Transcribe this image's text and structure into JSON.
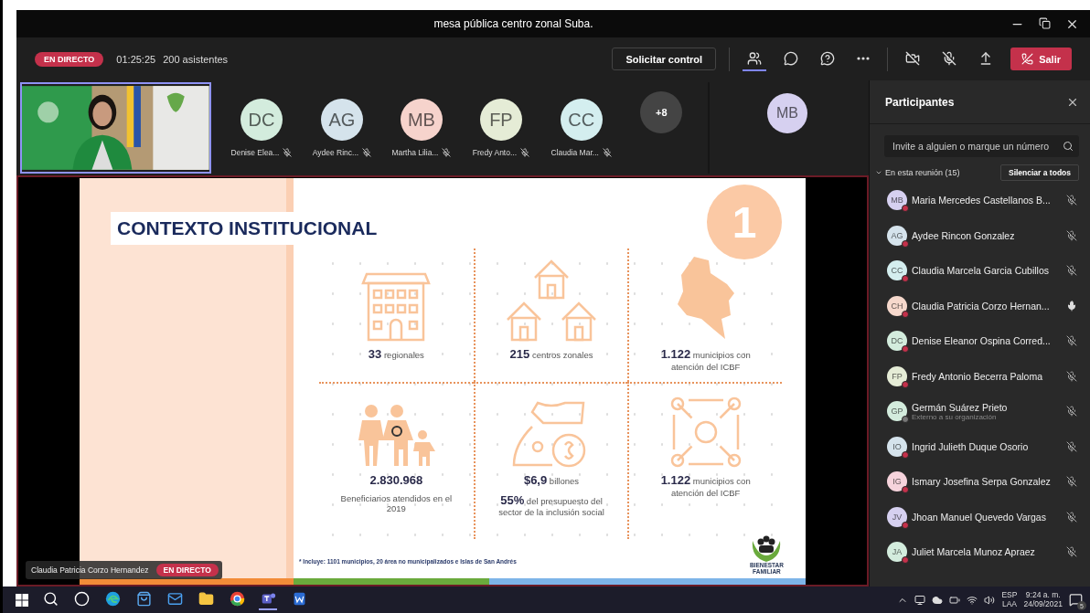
{
  "window": {
    "title": "mesa pública centro zonal Suba."
  },
  "toolbar": {
    "live_badge": "EN DIRECTO",
    "elapsed": "01:25:25",
    "attendees": "200 asistentes",
    "request_control": "Solicitar control",
    "actions": [
      {
        "kind": "people",
        "selected": true
      },
      {
        "kind": "chat",
        "selected": false
      },
      {
        "kind": "qa",
        "selected": false
      },
      {
        "kind": "more",
        "selected": false
      }
    ],
    "devices": [
      {
        "kind": "camera-off"
      },
      {
        "kind": "mic-off"
      },
      {
        "kind": "share"
      }
    ],
    "leave": "Salir"
  },
  "gallery": {
    "tiles": [
      {
        "initials": "DC",
        "name": "Denise Elea...",
        "color": "#d3ecdd"
      },
      {
        "initials": "AG",
        "name": "Aydee Rinc...",
        "color": "#d5e3ec"
      },
      {
        "initials": "MB",
        "name": "Martha Lilia...",
        "color": "#f6d3cc"
      },
      {
        "initials": "FP",
        "name": "Fredy Anto...",
        "color": "#e5ecd6"
      },
      {
        "initials": "CC",
        "name": "Claudia Mar...",
        "color": "#d4eeef"
      }
    ],
    "overflow": "+8",
    "spotlight": {
      "initials": "MB",
      "color": "#d6d0f0"
    }
  },
  "slide": {
    "title": "CONTEXTO INSTITUCIONAL",
    "number": "1",
    "stats": [
      {
        "lines": [
          "**33** regionales"
        ]
      },
      {
        "lines": [
          "**215** centros zonales"
        ]
      },
      {
        "lines": [
          "**1.122** municipios con atención del ICBF"
        ]
      },
      {
        "lines": [
          "**2.830.968**",
          "Beneficiarios atendidos en el 2019"
        ]
      },
      {
        "lines": [
          "**$6,9** billones",
          "**55%** del presupuesto del sector de la inclusión social"
        ]
      },
      {
        "lines": [
          "**1.122** municipios con atención del ICBF"
        ]
      }
    ],
    "footnote": "* Incluye: 1101 municipios, 20 área no municipalizados e Islas de San Andrés",
    "logo": [
      "BIENESTAR",
      "FAMILIAR"
    ]
  },
  "presenter_caption": {
    "name": "Claudia Patricia Corzo Hernandez",
    "badge": "EN DIRECTO"
  },
  "participants_panel": {
    "title": "Participantes",
    "search": {
      "placeholder": "Invite a alguien o marque un número"
    },
    "section": {
      "label": "En esta reunión (15)",
      "expanded": true
    },
    "mute_all": "Silenciar a todos",
    "people": [
      {
        "initials": "MB",
        "name": "Maria Mercedes Castellanos B...",
        "color": "#d6d0f0",
        "muted": true
      },
      {
        "initials": "AG",
        "name": "Aydee Rincon Gonzalez",
        "color": "#d5e3ec",
        "muted": true
      },
      {
        "initials": "CC",
        "name": "Claudia Marcela Garcia Cubillos",
        "color": "#d4eeef",
        "muted": true
      },
      {
        "initials": "CH",
        "name": "Claudia Patricia Corzo Hernan...",
        "color": "#f6d8cc",
        "muted": false
      },
      {
        "initials": "DC",
        "name": "Denise Eleanor Ospina Corred...",
        "color": "#d3ecdd",
        "muted": true
      },
      {
        "initials": "FP",
        "name": "Fredy Antonio Becerra Paloma",
        "color": "#e5ecd6",
        "muted": true
      },
      {
        "initials": "GP",
        "name": "Germán Suárez Prieto",
        "subtitle": "Externo a su organización",
        "color": "#d3ecdd",
        "muted": true
      },
      {
        "initials": "IO",
        "name": "Ingrid Julieth Duque Osorio",
        "color": "#d5e3ec",
        "muted": true
      },
      {
        "initials": "IG",
        "name": "Ismary Josefina Serpa Gonzalez",
        "color": "#f6d3dc",
        "muted": true
      },
      {
        "initials": "JV",
        "name": "Jhoan Manuel Quevedo Vargas",
        "color": "#d6d0f0",
        "muted": true
      },
      {
        "initials": "JA",
        "name": "Juliet Marcela Munoz Apraez",
        "color": "#d3ecdd",
        "muted": true
      }
    ]
  },
  "taskbar": {
    "apps": [
      {
        "kind": "search"
      },
      {
        "kind": "cortana"
      },
      {
        "kind": "edge"
      },
      {
        "kind": "store"
      },
      {
        "kind": "mail"
      },
      {
        "kind": "folder"
      },
      {
        "kind": "chrome"
      },
      {
        "kind": "teams",
        "selected": true
      },
      {
        "kind": "word",
        "selected": false
      }
    ],
    "language": "ESP",
    "layout": "LAA",
    "time": "9:24 a. m.",
    "date": "24/09/2021",
    "notifications": "5"
  }
}
